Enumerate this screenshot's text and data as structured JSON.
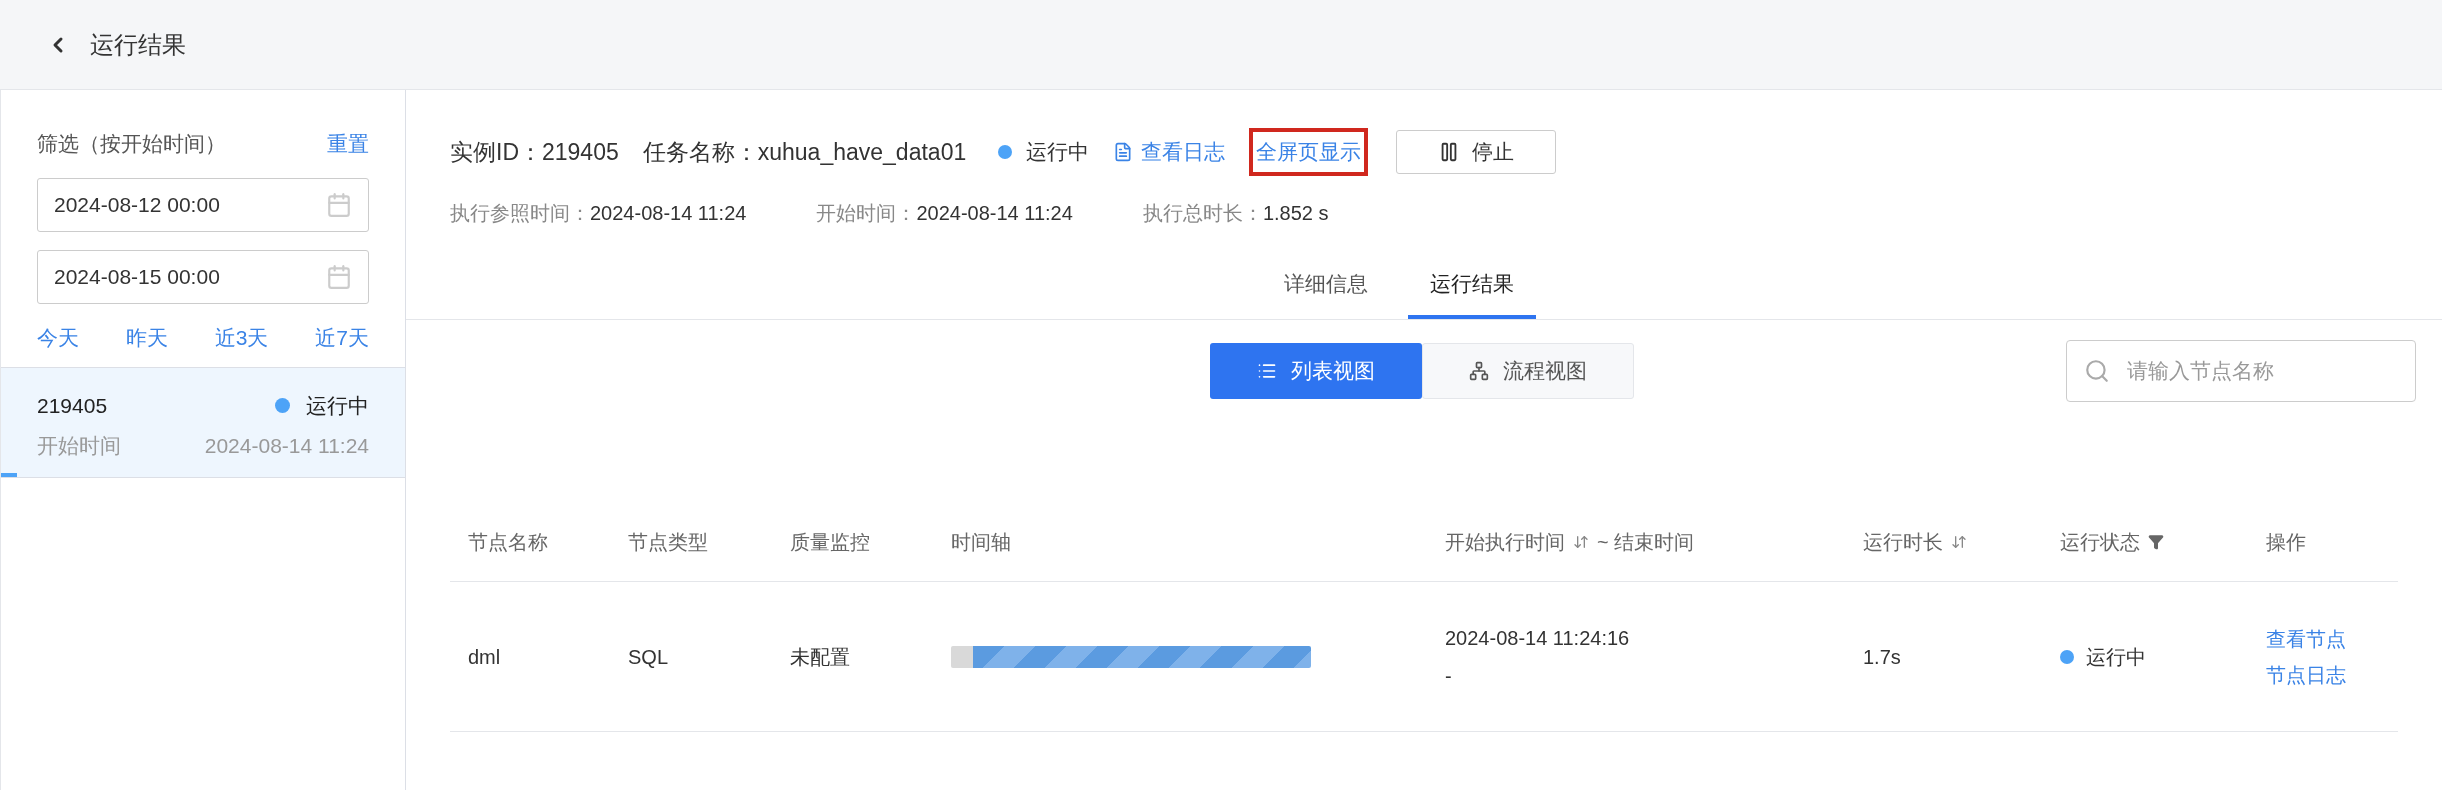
{
  "header": {
    "title": "运行结果"
  },
  "sidebar": {
    "filter_label": "筛选（按开始时间）",
    "reset": "重置",
    "start_date": "2024-08-12 00:00",
    "end_date": "2024-08-15 00:00",
    "quick_ranges": [
      "今天",
      "昨天",
      "近3天",
      "近7天"
    ],
    "items": [
      {
        "id": "219405",
        "status": "运行中",
        "color": "#4da3f7",
        "time_label": "开始时间",
        "time": "2024-08-14 11:24",
        "selected": true
      }
    ]
  },
  "instance": {
    "id_label": "实例ID：",
    "id": "219405",
    "task_label": "任务名称：",
    "task": "xuhua_have_data01",
    "status": "运行中",
    "color": "#4da3f7",
    "view_log": "查看日志",
    "fullscreen": "全屏页显示",
    "fullscreen_highlighted": true,
    "stop": "停止",
    "meta": [
      {
        "label": "执行参照时间：",
        "value": "2024-08-14 11:24"
      },
      {
        "label": "开始时间：",
        "value": "2024-08-14 11:24"
      },
      {
        "label": "执行总时长：",
        "value": "1.852 s"
      }
    ]
  },
  "tabs": [
    {
      "label": "详细信息",
      "selected": false
    },
    {
      "label": "运行结果",
      "selected": true
    }
  ],
  "view_toggle": [
    {
      "label": "列表视图",
      "kind": "list",
      "selected": true
    },
    {
      "label": "流程视图",
      "kind": "flow",
      "selected": false
    }
  ],
  "search": {
    "placeholder": "请输入节点名称"
  },
  "table": {
    "columns": [
      {
        "label": "节点名称"
      },
      {
        "label": "节点类型"
      },
      {
        "label": "质量监控"
      },
      {
        "label": "时间轴"
      },
      {
        "label": "开始执行时间",
        "sortable": true,
        "suffix": "~ 结束时间"
      },
      {
        "label": "运行时长",
        "sortable": true
      },
      {
        "label": "运行状态",
        "filter": true
      },
      {
        "label": "操作"
      }
    ],
    "rows": [
      {
        "name": "dml",
        "type": "SQL",
        "quality": "未配置",
        "start": "2024-08-14 11:24:16",
        "end": "-",
        "duration": "1.7s",
        "status": "运行中",
        "color": "#4da3f7",
        "actions": [
          "查看节点",
          "节点日志"
        ]
      }
    ]
  }
}
